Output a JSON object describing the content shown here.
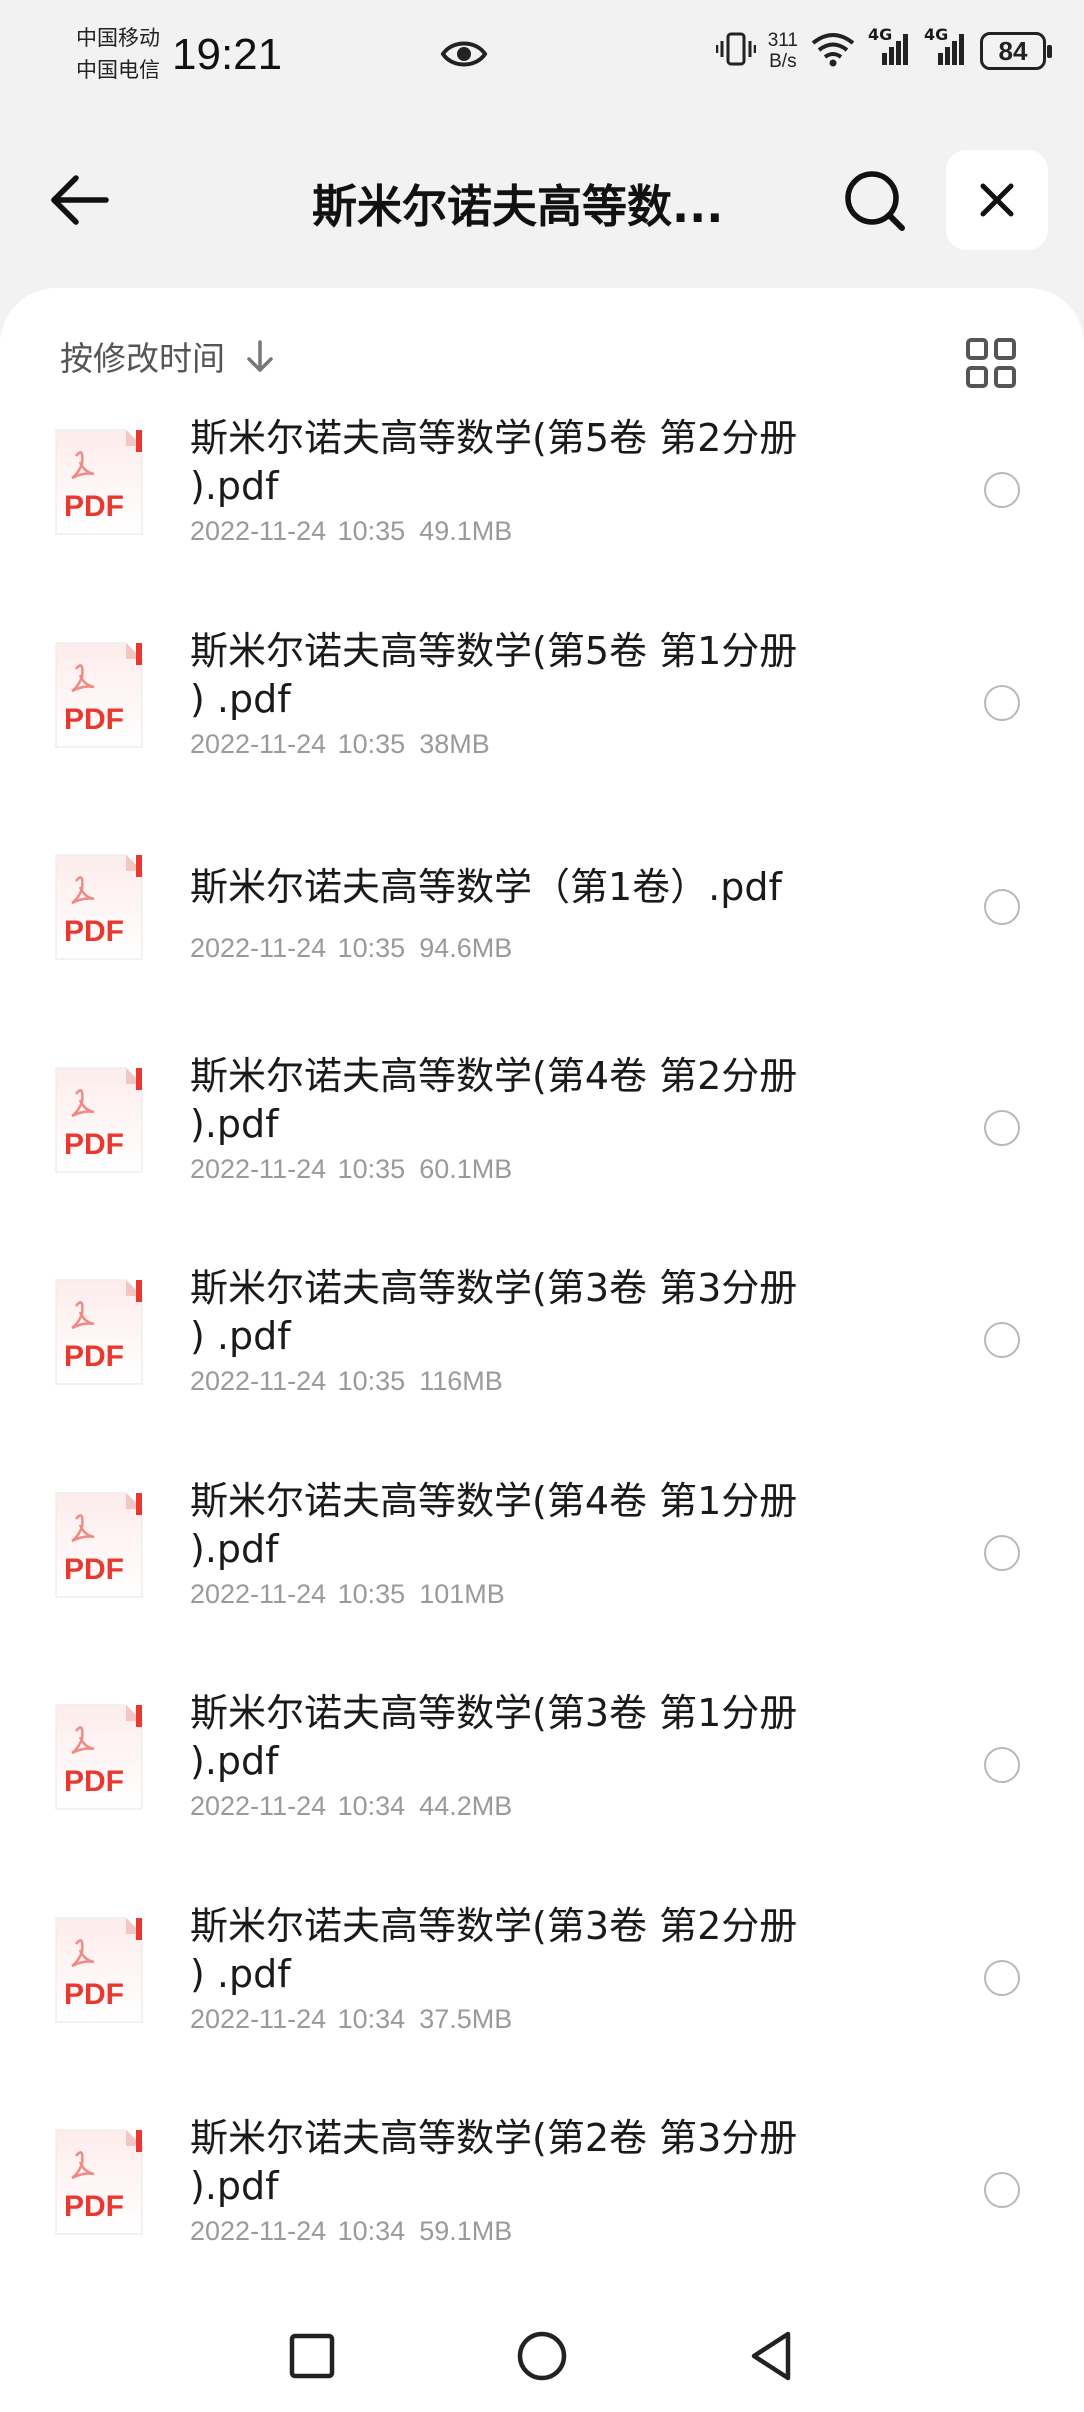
{
  "status": {
    "carrier_1": "中国移动",
    "carrier_2": "中国电信",
    "time": "19:21",
    "speed_value": "311",
    "speed_unit": "B/s",
    "net_1": "4G",
    "net_2": "4G",
    "battery": "84"
  },
  "header": {
    "title": "斯米尔诺夫高等数..."
  },
  "sort": {
    "label": "按修改时间"
  },
  "colors": {
    "pdf_red": "#e8382f",
    "card_bg": "#ffffff",
    "page_bg": "#f2f2f2"
  },
  "files": [
    {
      "name_line1": "斯米尔诺夫高等数学(第5卷 第2分册",
      "name_line2": ").pdf",
      "date": "2022-11-24 10:35",
      "size": "49.1MB",
      "icon_label": "PDF"
    },
    {
      "name_line1": "斯米尔诺夫高等数学(第5卷 第1分册",
      "name_line2": ") .pdf",
      "date": "2022-11-24 10:35",
      "size": "38MB",
      "icon_label": "PDF"
    },
    {
      "name_line1": "斯米尔诺夫高等数学（第1卷）.pdf",
      "name_line2": "",
      "date": "2022-11-24 10:35",
      "size": "94.6MB",
      "icon_label": "PDF"
    },
    {
      "name_line1": "斯米尔诺夫高等数学(第4卷 第2分册",
      "name_line2": ").pdf",
      "date": "2022-11-24 10:35",
      "size": "60.1MB",
      "icon_label": "PDF"
    },
    {
      "name_line1": "斯米尔诺夫高等数学(第3卷 第3分册",
      "name_line2": ") .pdf",
      "date": "2022-11-24 10:35",
      "size": "116MB",
      "icon_label": "PDF"
    },
    {
      "name_line1": "斯米尔诺夫高等数学(第4卷 第1分册",
      "name_line2": ").pdf",
      "date": "2022-11-24 10:35",
      "size": "101MB",
      "icon_label": "PDF"
    },
    {
      "name_line1": "斯米尔诺夫高等数学(第3卷 第1分册",
      "name_line2": ").pdf",
      "date": "2022-11-24 10:34",
      "size": "44.2MB",
      "icon_label": "PDF"
    },
    {
      "name_line1": "斯米尔诺夫高等数学(第3卷 第2分册",
      "name_line2": ") .pdf",
      "date": "2022-11-24 10:34",
      "size": "37.5MB",
      "icon_label": "PDF"
    },
    {
      "name_line1": "斯米尔诺夫高等数学(第2卷 第3分册",
      "name_line2": ").pdf",
      "date": "2022-11-24 10:34",
      "size": "59.1MB",
      "icon_label": "PDF"
    }
  ]
}
